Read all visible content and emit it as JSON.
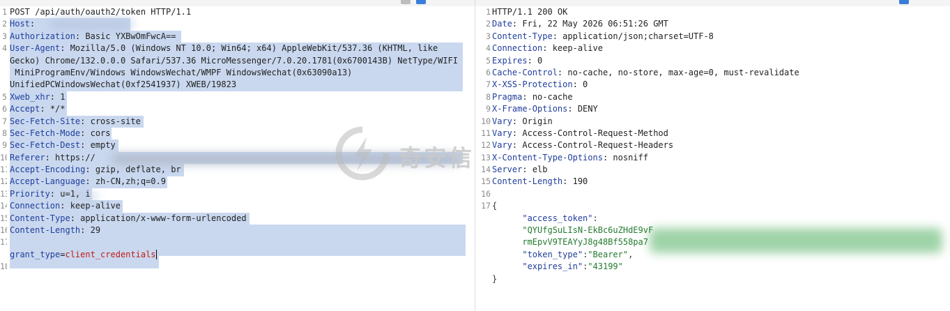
{
  "request": {
    "start_line": "POST /api/auth/oauth2/token HTTP/1.1",
    "headers": [
      {
        "name": "Host",
        "value": ""
      },
      {
        "name": "Authorization",
        "value": "Basic YXBwOmFwcA=="
      },
      {
        "name": "User-Agent",
        "value": "Mozilla/5.0 (Windows NT 10.0; Win64; x64) AppleWebKit/537.36 (KHTML, like"
      },
      {
        "name": "",
        "value": "Gecko) Chrome/132.0.0.0 Safari/537.36 MicroMessenger/7.0.20.1781(0x6700143B) NetType/WIFI"
      },
      {
        "name": "",
        "value": " MiniProgramEnv/Windows WindowsWechat/WMPF WindowsWechat(0x63090a13)"
      },
      {
        "name": "",
        "value": "UnifiedPCWindowsWechat(0xf2541937) XWEB/19823"
      },
      {
        "name": "Xweb_xhr",
        "value": "1"
      },
      {
        "name": "Accept",
        "value": "*/*"
      },
      {
        "name": "Sec-Fetch-Site",
        "value": "cross-site"
      },
      {
        "name": "Sec-Fetch-Mode",
        "value": "cors"
      },
      {
        "name": "Sec-Fetch-Dest",
        "value": "empty"
      },
      {
        "name": "Referer",
        "value": "https://"
      },
      {
        "name": "Accept-Encoding",
        "value": "gzip, deflate, br"
      },
      {
        "name": "Accept-Language",
        "value": "zh-CN,zh;q=0.9"
      },
      {
        "name": "Priority",
        "value": "u=1, i"
      },
      {
        "name": "Connection",
        "value": "keep-alive"
      },
      {
        "name": "Content-Type",
        "value": "application/x-www-form-urlencoded"
      },
      {
        "name": "Content-Length",
        "value": "29"
      }
    ],
    "body": {
      "param_name": "grant_type",
      "param_value": "client_credentials"
    },
    "line_numbers": [
      "1",
      "2",
      "3",
      "4",
      "",
      "",
      "",
      "5",
      "6",
      "7",
      "8",
      "9",
      "10",
      "11",
      "12",
      "13",
      "14",
      "15",
      "16",
      "17",
      "",
      "18"
    ]
  },
  "response": {
    "status_line": "HTTP/1.1 200 OK",
    "headers": [
      {
        "name": "Date",
        "value": "Fri, 22 May 2026 06:51:26 GMT"
      },
      {
        "name": "Content-Type",
        "value": "application/json;charset=UTF-8"
      },
      {
        "name": "Connection",
        "value": "keep-alive"
      },
      {
        "name": "Expires",
        "value": "0"
      },
      {
        "name": "Cache-Control",
        "value": "no-cache, no-store, max-age=0, must-revalidate"
      },
      {
        "name": "X-XSS-Protection",
        "value": "0"
      },
      {
        "name": "Pragma",
        "value": "no-cache"
      },
      {
        "name": "X-Frame-Options",
        "value": "DENY"
      },
      {
        "name": "Vary",
        "value": "Origin"
      },
      {
        "name": "Vary",
        "value": "Access-Control-Request-Method"
      },
      {
        "name": "Vary",
        "value": "Access-Control-Request-Headers"
      },
      {
        "name": "X-Content-Type-Options",
        "value": "nosniff"
      },
      {
        "name": "Server",
        "value": "elb"
      },
      {
        "name": "Content-Length",
        "value": "190"
      }
    ],
    "json": {
      "open": "{",
      "close": "}",
      "access_token_key": "\"access_token\"",
      "access_token_line1": "\"QYUfgSuLIsN-EkBc6uZHdE9vF",
      "access_token_line2": "rmEpvV9TEAYyJ8g48Bf558pa7",
      "token_type_key": "\"token_type\"",
      "token_type_value": "\"Bearer\"",
      "expires_in_key": "\"expires_in\"",
      "expires_in_value": "\"43199\""
    },
    "line_numbers": [
      "1",
      "2",
      "3",
      "4",
      "5",
      "6",
      "7",
      "8",
      "9",
      "10",
      "11",
      "12",
      "13",
      "14",
      "15",
      "16",
      "17"
    ]
  },
  "watermark": {
    "text": "奇安信"
  },
  "colors": {
    "selection": "#c9d8ef",
    "header_name": "#1f3d9c",
    "param_value": "#c41a16",
    "json_string": "#237a2e",
    "toolbar_accent": "#3b7ddd"
  }
}
